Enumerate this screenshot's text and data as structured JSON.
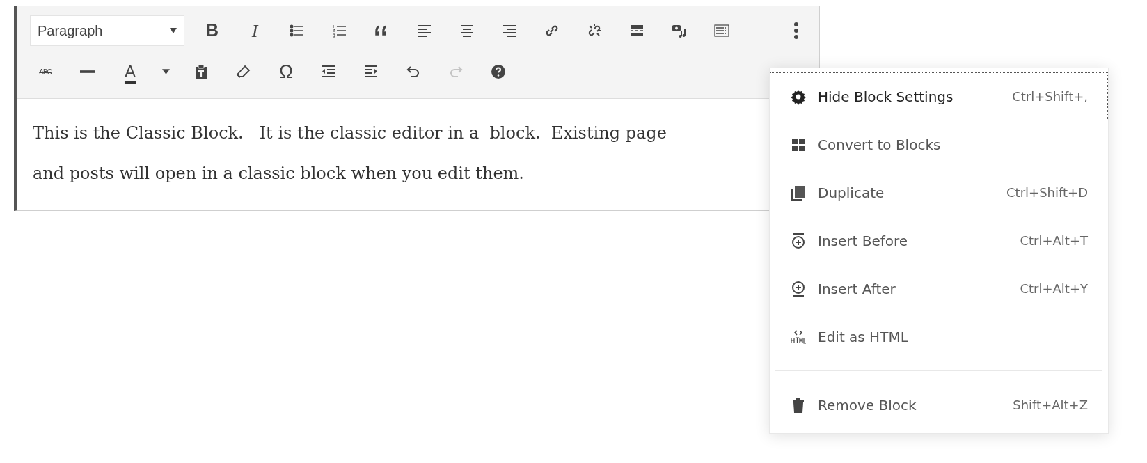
{
  "toolbar": {
    "format": "Paragraph",
    "row_1": [
      {
        "glyph": "B",
        "disabled": false
      },
      {
        "glyph": "I",
        "disabled": false
      },
      {
        "disabled": false
      },
      {
        "disabled": false
      },
      {
        "disabled": false
      },
      {
        "disabled": false
      },
      {
        "disabled": false
      },
      {
        "disabled": false
      },
      {
        "disabled": false
      },
      {
        "disabled": false
      },
      {
        "disabled": false
      },
      {
        "disabled": false
      },
      {
        "disabled": false
      }
    ],
    "row_2": [
      {
        "glyph": "ABC",
        "disabled": false
      },
      {
        "disabled": false
      },
      {
        "glyph": "A",
        "disabled": false
      },
      {
        "disabled": false
      },
      {
        "disabled": false
      },
      {
        "disabled": false
      },
      {
        "glyph": "Ω",
        "disabled": false
      },
      {
        "disabled": false
      },
      {
        "disabled": false
      },
      {
        "disabled": false
      },
      {
        "disabled": true
      },
      {
        "disabled": false
      }
    ]
  },
  "content": {
    "lines": [
      "This is the Classic Block.   It is the classic editor in a  block.  Existing page",
      "and posts will open in a classic block when you edit them."
    ]
  },
  "menu": {
    "groups": [
      [
        {
          "label": "Hide Block Settings",
          "shortcut": "Ctrl+Shift+,",
          "focused": true
        },
        {
          "label": "Convert to Blocks",
          "focused": false
        },
        {
          "label": "Duplicate",
          "shortcut": "Ctrl+Shift+D",
          "focused": false
        },
        {
          "label": "Insert Before",
          "shortcut": "Ctrl+Alt+T",
          "focused": false
        },
        {
          "label": "Insert After",
          "shortcut": "Ctrl+Alt+Y",
          "focused": false
        },
        {
          "label": "Edit as HTML",
          "focused": false
        }
      ],
      [
        {
          "label": "Remove Block",
          "shortcut": "Shift+Alt+Z",
          "focused": false
        }
      ]
    ]
  }
}
